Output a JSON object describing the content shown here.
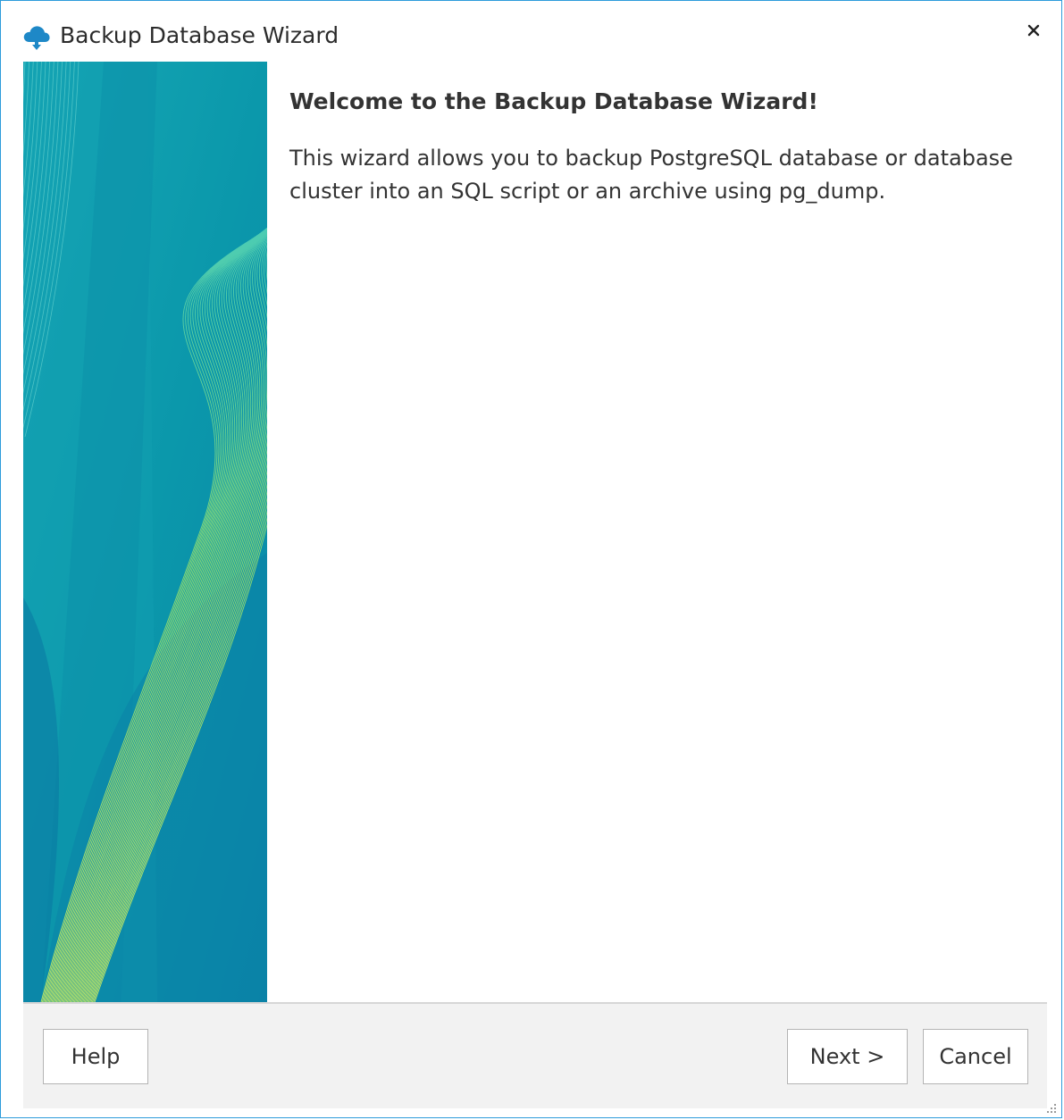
{
  "window": {
    "title": "Backup Database Wizard"
  },
  "icons": {
    "app": "cloud-download-icon",
    "close": "close-icon",
    "grip": "resize-grip-icon"
  },
  "content": {
    "heading": "Welcome to the Backup Database Wizard!",
    "description": "This wizard allows you to backup PostgreSQL database or database cluster into an SQL script or an archive using pg_dump."
  },
  "footer": {
    "help_label": "Help",
    "next_label": "Next >",
    "cancel_label": "Cancel"
  },
  "colors": {
    "window_border": "#2d9cdb",
    "banner_base": "#0e96a8",
    "banner_accent": "#c7f25a",
    "footer_bg": "#f2f2f2"
  }
}
